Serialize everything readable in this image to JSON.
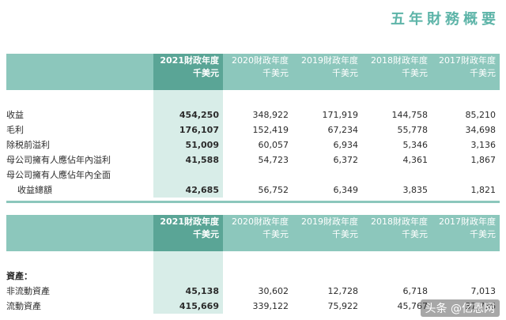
{
  "page_title": "五年財務概要",
  "columns": [
    {
      "year": "2021財政年度",
      "unit": "千美元"
    },
    {
      "year": "2020財政年度",
      "unit": "千美元"
    },
    {
      "year": "2019財政年度",
      "unit": "千美元"
    },
    {
      "year": "2018財政年度",
      "unit": "千美元"
    },
    {
      "year": "2017財政年度",
      "unit": "千美元"
    }
  ],
  "table1": [
    {
      "label": "收益",
      "values": [
        "454,250",
        "348,922",
        "171,919",
        "144,758",
        "85,210"
      ]
    },
    {
      "label": "毛利",
      "values": [
        "176,107",
        "152,419",
        "67,234",
        "55,778",
        "34,698"
      ]
    },
    {
      "label": "除税前溢利",
      "values": [
        "51,009",
        "60,057",
        "6,934",
        "5,346",
        "3,136"
      ]
    },
    {
      "label": "母公司擁有人應佔年內溢利",
      "values": [
        "41,588",
        "54,723",
        "6,372",
        "4,361",
        "1,867"
      ]
    },
    {
      "label": "母公司擁有人應佔年內全面",
      "values": [
        "",
        "",
        "",
        "",
        ""
      ]
    },
    {
      "label": "收益總額",
      "values": [
        "42,685",
        "56,752",
        "6,349",
        "3,835",
        "1,821"
      ]
    }
  ],
  "table2": [
    {
      "label": "資產：",
      "values": [
        "",
        "",
        "",
        "",
        ""
      ]
    },
    {
      "label": "非流動資產",
      "values": [
        "45,138",
        "30,602",
        "12,728",
        "6,718",
        "7,013"
      ]
    },
    {
      "label": "流動資產",
      "values": [
        "415,669",
        "339,122",
        "75,922",
        "45,767",
        "37,736"
      ]
    }
  ],
  "watermark": "头条 @亿恩网"
}
